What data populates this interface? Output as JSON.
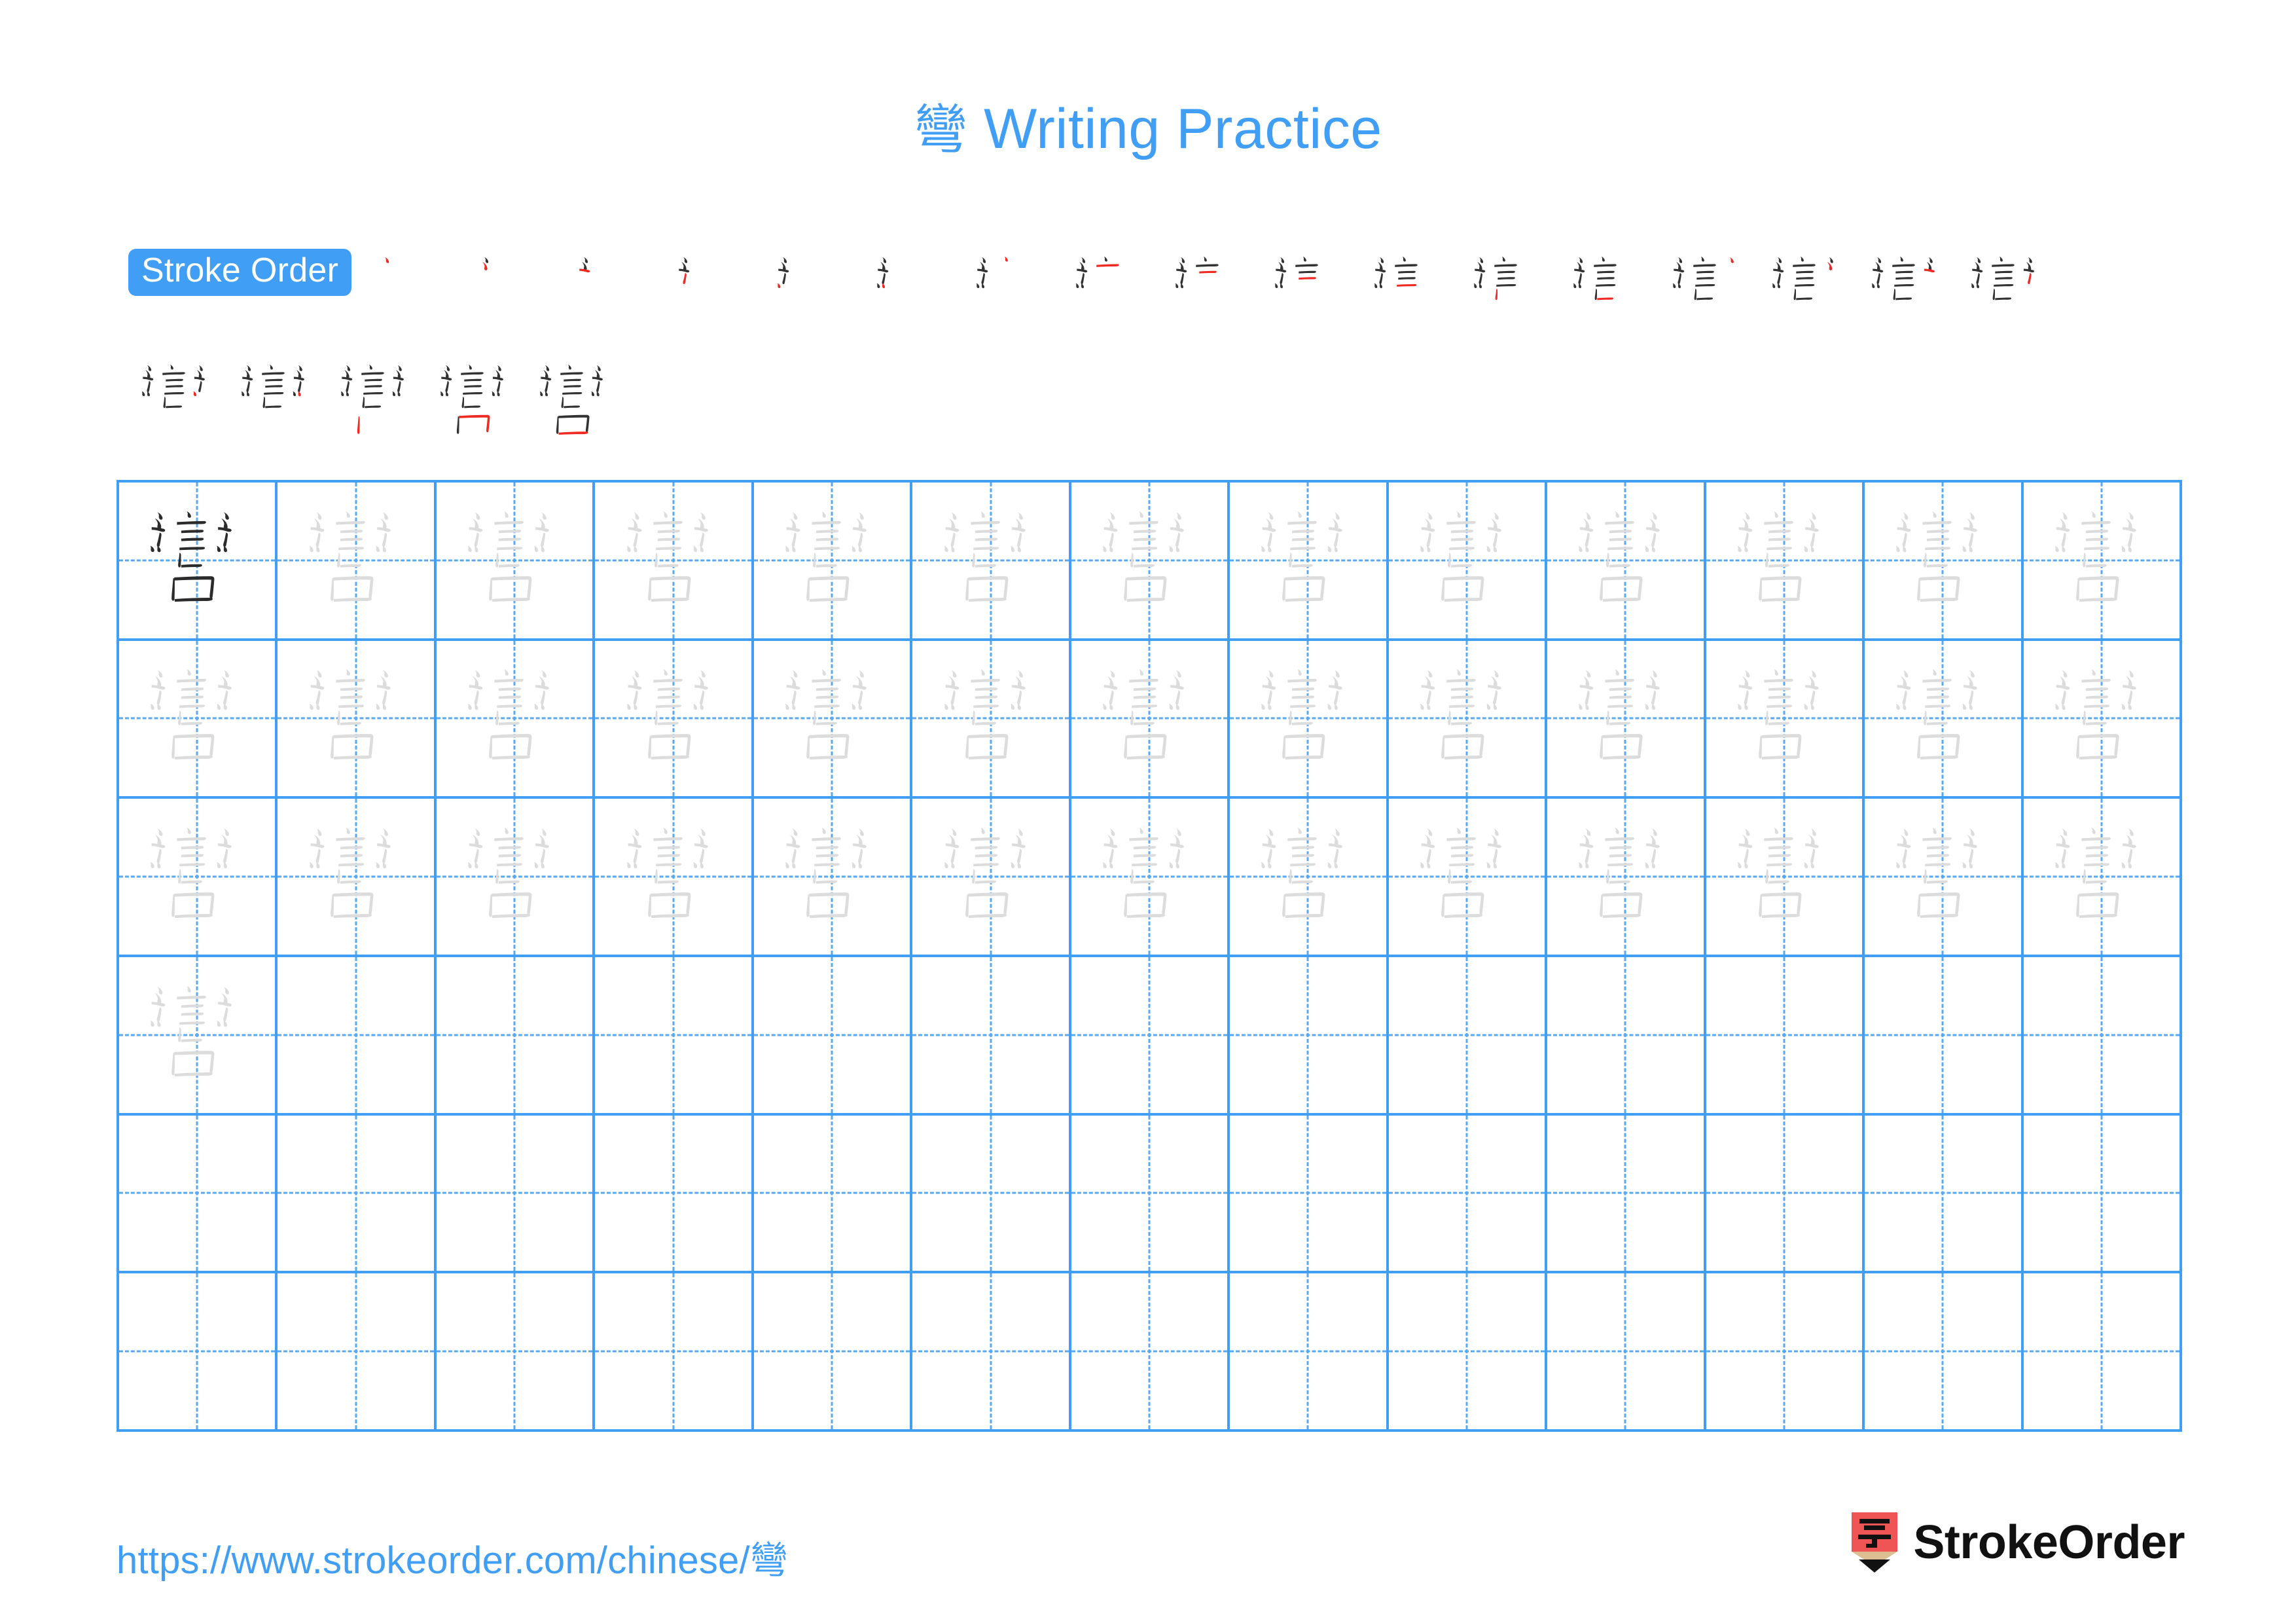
{
  "page": {
    "character": "彎",
    "title_suffix": " Writing Practice",
    "background_color": "#ffffff",
    "accent_color": "#409ef5",
    "stroke_done_color": "#333333",
    "stroke_new_color": "#ef2a23",
    "trace_color": "#dcdcdc",
    "model_color": "#2b2b2b"
  },
  "header": {
    "title_char": "彎",
    "title_text": " Writing Practice"
  },
  "stroke_order": {
    "badge_label": "Stroke Order",
    "total_strokes": 22,
    "steps": [
      {
        "index": 1,
        "new_strokes": 1
      },
      {
        "index": 2,
        "new_strokes": 1
      },
      {
        "index": 3,
        "new_strokes": 1
      },
      {
        "index": 4,
        "new_strokes": 1
      },
      {
        "index": 5,
        "new_strokes": 1
      },
      {
        "index": 6,
        "new_strokes": 1
      },
      {
        "index": 7,
        "new_strokes": 1
      },
      {
        "index": 8,
        "new_strokes": 1
      },
      {
        "index": 9,
        "new_strokes": 1
      },
      {
        "index": 10,
        "new_strokes": 1
      },
      {
        "index": 11,
        "new_strokes": 1
      },
      {
        "index": 12,
        "new_strokes": 1
      },
      {
        "index": 13,
        "new_strokes": 1
      },
      {
        "index": 14,
        "new_strokes": 1
      },
      {
        "index": 15,
        "new_strokes": 1
      },
      {
        "index": 16,
        "new_strokes": 1
      },
      {
        "index": 17,
        "new_strokes": 1
      },
      {
        "index": 18,
        "new_strokes": 1
      },
      {
        "index": 19,
        "new_strokes": 1
      },
      {
        "index": 20,
        "new_strokes": 1
      },
      {
        "index": 21,
        "new_strokes": 1
      },
      {
        "index": 22,
        "new_strokes": 1
      }
    ],
    "row1_count": 17,
    "row2_count": 5
  },
  "practice_grid": {
    "columns": 13,
    "rows": 6,
    "model_cell_index": 0,
    "traced_cell_count": 39,
    "empty_row_start": 3
  },
  "footer": {
    "url_text": "https://www.strokeorder.com/chinese/",
    "url_char": "彎",
    "brand_name": "StrokeOrder",
    "brand_mark_char": "字",
    "brand_mark_color": "#f05555",
    "brand_tip_color": "#ddbe93"
  }
}
